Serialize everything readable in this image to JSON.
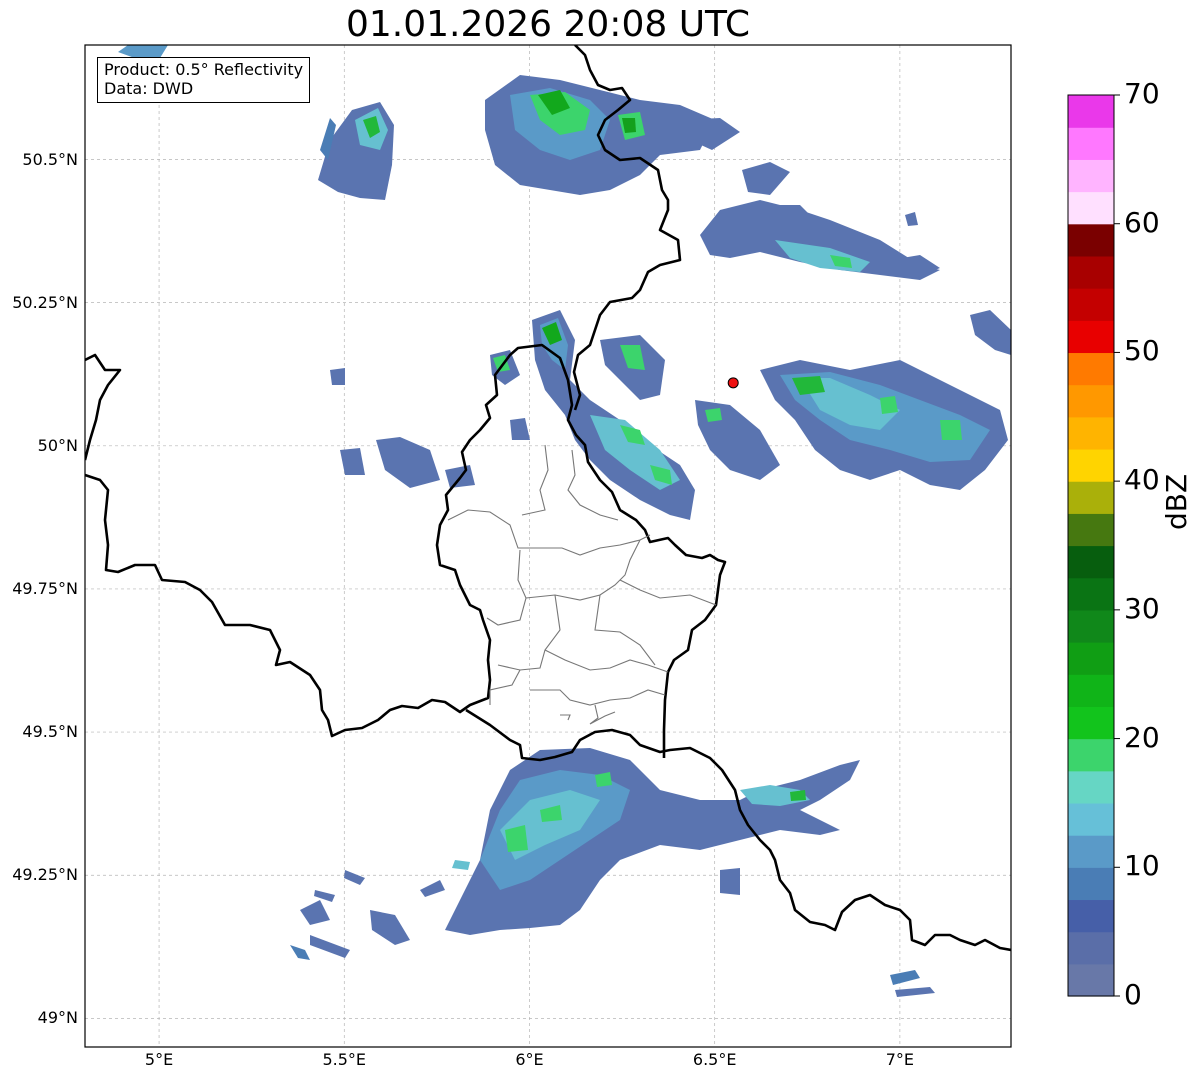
{
  "title": "01.01.2026 20:08 UTC",
  "info_box": {
    "line1": "Product: 0.5° Reflectivity",
    "line2": "Data: DWD"
  },
  "map": {
    "lon_range": [
      4.8,
      7.3
    ],
    "lat_range": [
      48.95,
      50.7
    ],
    "gridlines": true,
    "lat_ticks": [
      {
        "value": 50.5,
        "label": "50.5°N"
      },
      {
        "value": 50.25,
        "label": "50.25°N"
      },
      {
        "value": 50.0,
        "label": "50°N"
      },
      {
        "value": 49.75,
        "label": "49.75°N"
      },
      {
        "value": 49.5,
        "label": "49.5°N"
      },
      {
        "value": 49.25,
        "label": "49.25°N"
      },
      {
        "value": 49.0,
        "label": "49°N"
      }
    ],
    "lon_ticks": [
      {
        "value": 5.0,
        "label": "5°E"
      },
      {
        "value": 5.5,
        "label": "5.5°E"
      },
      {
        "value": 6.0,
        "label": "6°E"
      },
      {
        "value": 6.5,
        "label": "6.5°E"
      },
      {
        "value": 7.0,
        "label": "7°E"
      }
    ],
    "radar_site": {
      "lon": 6.55,
      "lat": 50.11,
      "color": "#ee1111"
    }
  },
  "colorbar": {
    "label": "dBZ",
    "min": 0,
    "max": 70,
    "ticks": [
      {
        "value": 70,
        "label": "70"
      },
      {
        "value": 60,
        "label": "60"
      },
      {
        "value": 50,
        "label": "50"
      },
      {
        "value": 40,
        "label": "40"
      },
      {
        "value": 30,
        "label": "30"
      },
      {
        "value": 20,
        "label": "20"
      },
      {
        "value": 10,
        "label": "10"
      },
      {
        "value": 0,
        "label": "0"
      }
    ],
    "colors": [
      "#6878a8",
      "#5a6ea8",
      "#465fa8",
      "#4a7db5",
      "#5a9ac8",
      "#66c0d8",
      "#66d6c4",
      "#3cd46c",
      "#12c41c",
      "#10b418",
      "#109e14",
      "#10881a",
      "#0a7414",
      "#075e0e",
      "#467810",
      "#aab00a",
      "#ffd400",
      "#ffb400",
      "#ff9800",
      "#ff7a00",
      "#e80000",
      "#c40000",
      "#a80000",
      "#7a0000",
      "#ffe0ff",
      "#ffb4ff",
      "#ff78ff",
      "#ea38ea"
    ]
  }
}
